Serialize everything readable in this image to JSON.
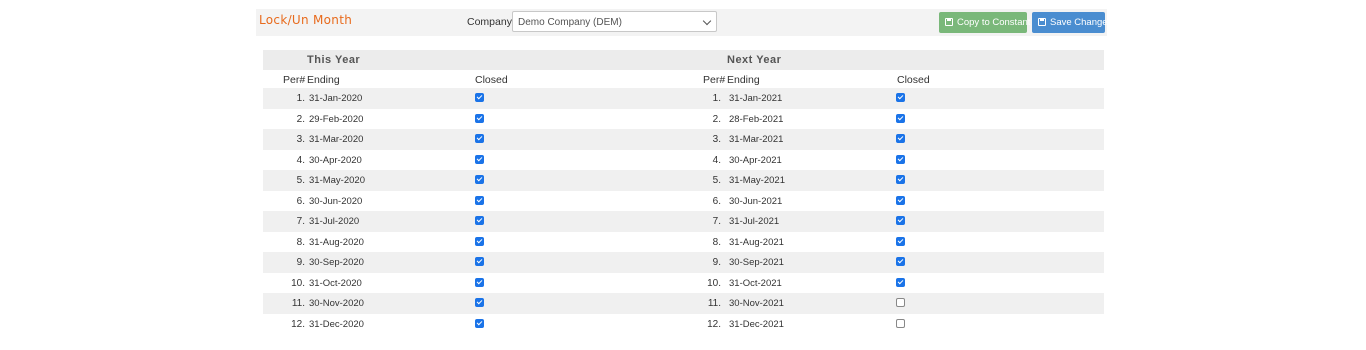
{
  "toolbar": {
    "title": "Lock/Un Month",
    "company_label": "Company:",
    "company_value": "Demo Company (DEM)",
    "copy_button": "Copy to Constant",
    "save_button": "Save Changes"
  },
  "groups": {
    "this_year": "This Year",
    "next_year": "Next Year"
  },
  "columns": {
    "per": "Per#",
    "ending": "Ending",
    "closed": "Closed"
  },
  "rows": [
    {
      "per": "1.",
      "this_ending": "31-Jan-2020",
      "this_closed": true,
      "next_ending": "31-Jan-2021",
      "next_closed": true
    },
    {
      "per": "2.",
      "this_ending": "29-Feb-2020",
      "this_closed": true,
      "next_ending": "28-Feb-2021",
      "next_closed": true
    },
    {
      "per": "3.",
      "this_ending": "31-Mar-2020",
      "this_closed": true,
      "next_ending": "31-Mar-2021",
      "next_closed": true
    },
    {
      "per": "4.",
      "this_ending": "30-Apr-2020",
      "this_closed": true,
      "next_ending": "30-Apr-2021",
      "next_closed": true
    },
    {
      "per": "5.",
      "this_ending": "31-May-2020",
      "this_closed": true,
      "next_ending": "31-May-2021",
      "next_closed": true
    },
    {
      "per": "6.",
      "this_ending": "30-Jun-2020",
      "this_closed": true,
      "next_ending": "30-Jun-2021",
      "next_closed": true
    },
    {
      "per": "7.",
      "this_ending": "31-Jul-2020",
      "this_closed": true,
      "next_ending": "31-Jul-2021",
      "next_closed": true
    },
    {
      "per": "8.",
      "this_ending": "31-Aug-2020",
      "this_closed": true,
      "next_ending": "31-Aug-2021",
      "next_closed": true
    },
    {
      "per": "9.",
      "this_ending": "30-Sep-2020",
      "this_closed": true,
      "next_ending": "30-Sep-2021",
      "next_closed": true
    },
    {
      "per": "10.",
      "this_ending": "31-Oct-2020",
      "this_closed": true,
      "next_ending": "31-Oct-2021",
      "next_closed": true
    },
    {
      "per": "11.",
      "this_ending": "30-Nov-2020",
      "this_closed": true,
      "next_ending": "30-Nov-2021",
      "next_closed": false
    },
    {
      "per": "12.",
      "this_ending": "31-Dec-2020",
      "this_closed": true,
      "next_ending": "31-Dec-2021",
      "next_closed": false
    }
  ],
  "colors": {
    "title": "#e86a1c",
    "copy_button": "#7ab87a",
    "save_button": "#4a8dd0",
    "checkbox_checked": "#1a73e8"
  },
  "icons": {
    "copy_button": "floppy-disk-icon",
    "save_button": "floppy-disk-icon",
    "select": "chevron-down-icon"
  }
}
